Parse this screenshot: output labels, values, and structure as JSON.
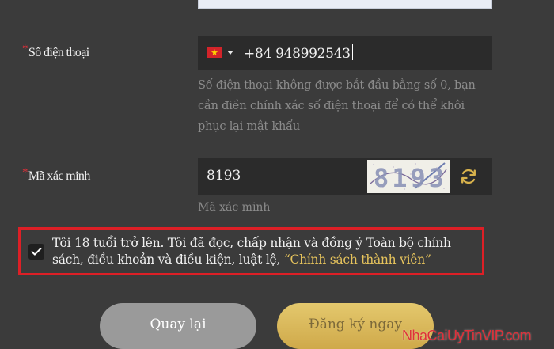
{
  "phone": {
    "label": "Số điện thoại",
    "required_mark": "*",
    "country_flag": "vietnam-flag-icon",
    "value": "+84 948992543",
    "hint": "Số điện thoại không được bắt đầu bằng số 0, bạn cần điền chính xác số điện thoại để có thể khôi phục lại mật khẩu"
  },
  "captcha": {
    "label": "Mã xác minh",
    "required_mark": "*",
    "value": "8193",
    "image_text": "8193",
    "placeholder_hint": "Mã xác minh",
    "refresh_icon": "refresh-icon"
  },
  "agreement": {
    "checked": true,
    "text": "Tôi 18 tuổi trở lên. Tôi đã đọc, chấp nhận và đồng ý Toàn bộ chính sách, điều khoản và điều kiện, luật lệ, ",
    "link": "“Chính sách thành viên”"
  },
  "buttons": {
    "back": "Quay lại",
    "register": "Đăng ký ngay"
  },
  "watermark": "NhaCaiUyTinVIP.com",
  "colors": {
    "background": "#3b3b3b",
    "input_bg": "#2b2b2b",
    "required": "#e0303a",
    "highlight_border": "#dd1f26",
    "link_gold": "#e6c35c",
    "register_gold": "#d4b152",
    "back_gray": "#9a9a9a"
  }
}
